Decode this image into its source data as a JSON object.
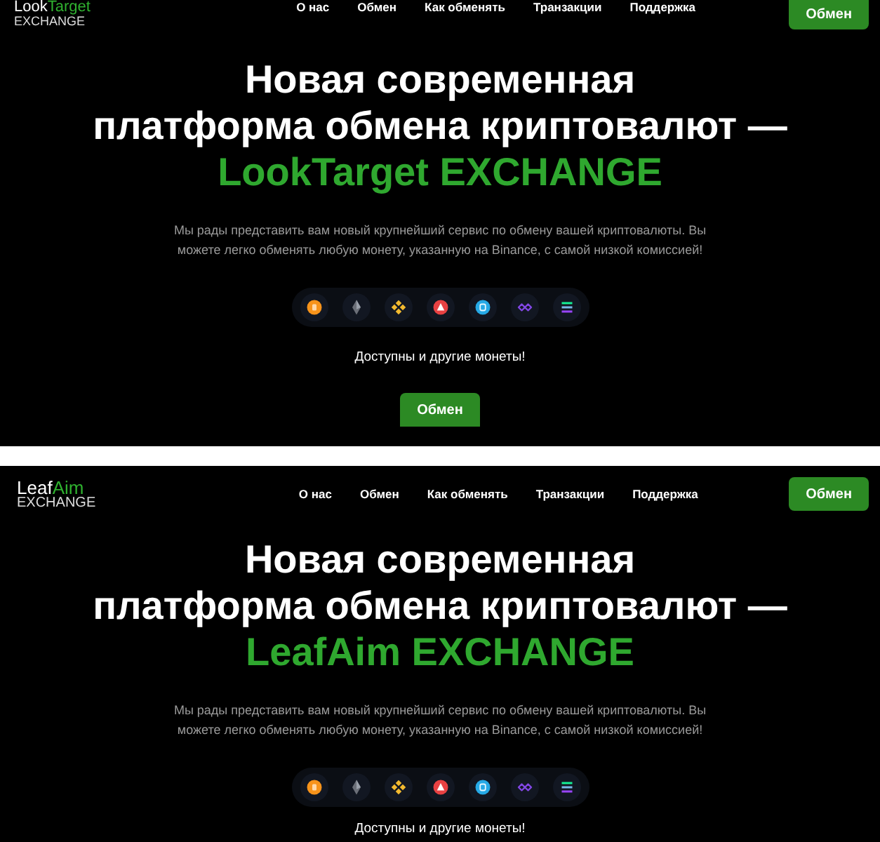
{
  "panels": [
    {
      "logo": {
        "first": "Look",
        "second": "Target",
        "sub": "EXCHANGE"
      },
      "nav": [
        "О нас",
        "Обмен",
        "Как обменять",
        "Транзакции",
        "Поддержка"
      ],
      "header_button": "Обмен",
      "heading_lines": [
        "Новая современная",
        "платформа обмена криптовалют —"
      ],
      "accent": "LookTarget EXCHANGE",
      "description": "Мы рады представить вам новый крупнейший сервис по обмену вашей криптовалюты. Вы можете легко обменять любую монету, указанную на Binance, с самой низкой комиссией!",
      "more_coins": "Доступны и другие монеты!",
      "cta": "Обмен"
    },
    {
      "logo": {
        "first": "Leaf",
        "second": "Aim",
        "sub": "EXCHANGE"
      },
      "nav": [
        "О нас",
        "Обмен",
        "Как обменять",
        "Транзакции",
        "Поддержка"
      ],
      "header_button": "Обмен",
      "heading_lines": [
        "Новая современная",
        "платформа обмена криптовалют —"
      ],
      "accent": "LeafAim EXCHANGE",
      "description": "Мы рады представить вам новый крупнейший сервис по обмену вашей криптовалюты. Вы можете легко обменять любую монету, указанную на Binance, с самой низкой комиссией!",
      "more_coins": "Доступны и другие монеты!"
    }
  ]
}
